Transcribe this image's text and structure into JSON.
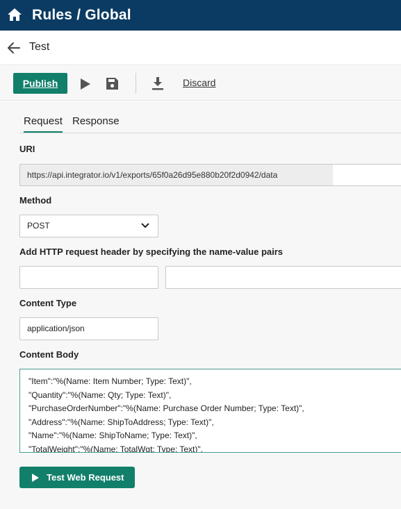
{
  "header": {
    "section": "Rules",
    "separator": "/",
    "page": "Global"
  },
  "subheader": {
    "title": "Test"
  },
  "toolbar": {
    "publish_label": "Publish",
    "discard_label": "Discard"
  },
  "tabs": [
    {
      "label": "Request",
      "active": true
    },
    {
      "label": "Response",
      "active": false
    }
  ],
  "form": {
    "uri_label": "URI",
    "uri_value": "https://api.integrator.io/v1/exports/65f0a26d95e880b20f2d0942/data",
    "method_label": "Method",
    "method_value": "POST",
    "headers_label": "Add HTTP request header by specifying the name-value pairs",
    "content_type_label": "Content Type",
    "content_type_value": "application/json",
    "content_body_label": "Content Body",
    "content_body_lines": [
      "\"Item\":\"%(Name: Item Number; Type: Text)\",",
      "\"Quantity\":\"%(Name: Qty; Type: Text)\",",
      "\"PurchaseOrderNumber\":\"%(Name: Purchase Order Number; Type: Text)\",",
      "\"Address\":\"%(Name: ShipToAddress; Type: Text)\",",
      "\"Name\":\"%(Name: ShipToName; Type: Text)\",",
      "\"TotalWeight\":\"%(Name: TotalWgt; Type: Text)\","
    ],
    "test_button_label": "Test Web Request"
  },
  "colors": {
    "topbar": "#0b3b62",
    "accent": "#117f6a"
  }
}
